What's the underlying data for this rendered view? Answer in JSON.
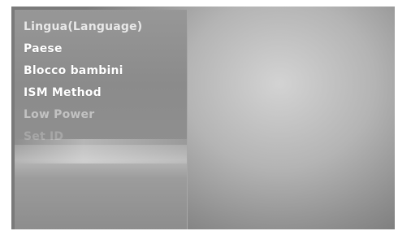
{
  "menu": {
    "items": [
      {
        "label": "Lingua(Language)"
      },
      {
        "label": "Paese"
      },
      {
        "label": "Blocco  bambini"
      },
      {
        "label": "ISM Method"
      },
      {
        "label": "Low Power"
      },
      {
        "label": "Set ID"
      }
    ]
  },
  "colors": {
    "menu_background": "#8f8f8f",
    "screen_background": "#b4b4b4",
    "enabled_text": "#ffffff",
    "disabled_text": "#a7a7a7"
  }
}
